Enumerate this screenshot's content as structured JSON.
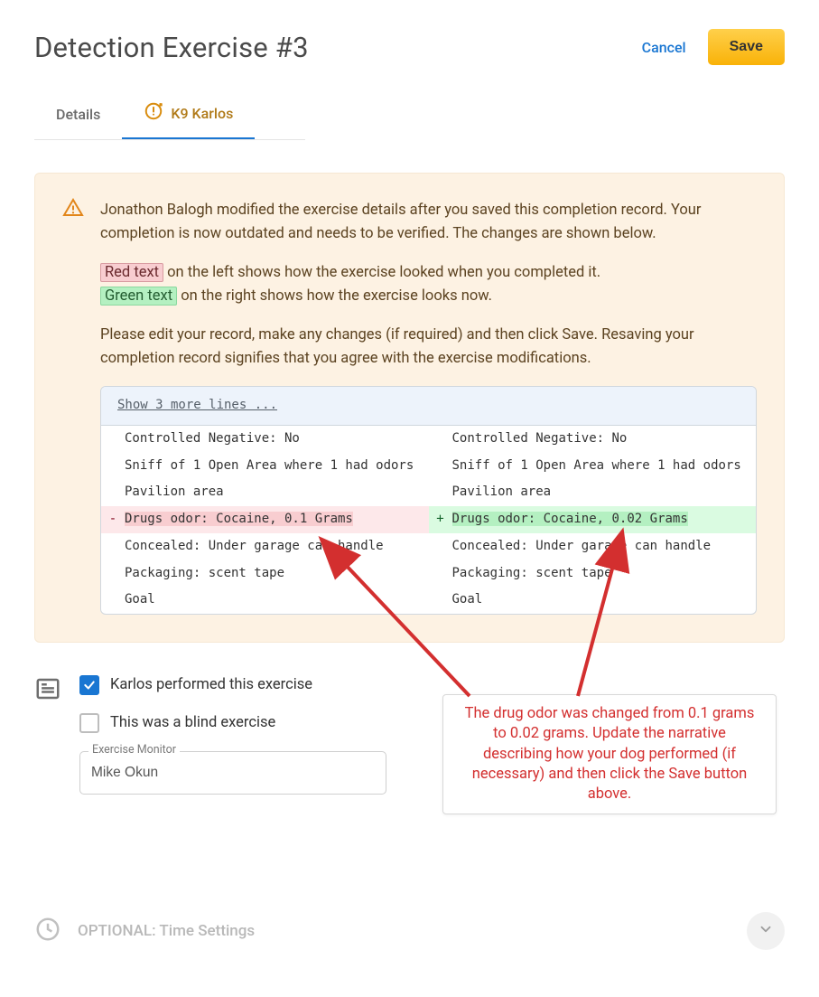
{
  "header": {
    "title": "Detection Exercise #3",
    "cancel": "Cancel",
    "save": "Save"
  },
  "tabs": {
    "details": "Details",
    "k9": "K9 Karlos"
  },
  "notice": {
    "p1": "Jonathon Balogh modified the exercise details after you saved this completion record. Your completion is now outdated and needs to be verified. The changes are shown below.",
    "red_label": "Red text",
    "red_after": " on the left shows how the exercise looked when you completed it.",
    "green_label": "Green text",
    "green_after": " on the right shows how the exercise looks now.",
    "p3": "Please edit your record, make any changes (if required) and then click Save. Resaving your completion record signifies that you agree with the exercise modifications."
  },
  "diff": {
    "show_more": "Show 3 more lines ...",
    "rows": [
      {
        "left": "Controlled Negative: No",
        "right": "Controlled Negative: No"
      },
      {
        "left": "Sniff of 1 Open Area where 1 had odors",
        "right": "Sniff of 1 Open Area where 1 had odors"
      },
      {
        "left": "Pavilion area",
        "right": "Pavilion area"
      },
      {
        "left": "Drugs odor: Cocaine, 0.1 Grams",
        "right": "Drugs odor: Cocaine, 0.02 Grams",
        "changed": true
      },
      {
        "left": "Concealed: Under garage can handle",
        "right": "Concealed: Under garage can handle"
      },
      {
        "left": "Packaging: scent tape",
        "right": "Packaging: scent tape"
      },
      {
        "left": "Goal",
        "right": "Goal"
      }
    ]
  },
  "form": {
    "performed_label": "Karlos performed this exercise",
    "blind_label": "This was a blind exercise",
    "monitor_label": "Exercise Monitor",
    "monitor_value": "Mike Okun"
  },
  "annotation": "The drug odor was changed from 0.1 grams to 0.02 grams. Update the narrative describing how your dog performed (if necessary) and then click the Save button above.",
  "optional": {
    "label": "OPTIONAL: Time Settings"
  }
}
